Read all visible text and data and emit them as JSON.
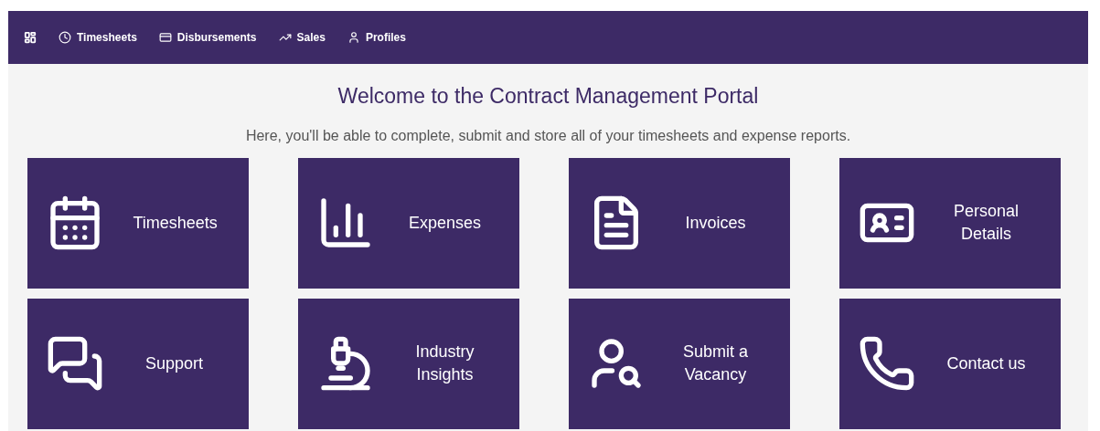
{
  "nav": {
    "items": [
      {
        "label": "Timesheets"
      },
      {
        "label": "Disbursements"
      },
      {
        "label": "Sales"
      },
      {
        "label": "Profiles"
      }
    ]
  },
  "title": "Welcome to the Contract Management Portal",
  "subtitle": "Here, you'll be able to complete, submit and store all of your timesheets and expense reports.",
  "tiles": [
    {
      "label": "Timesheets"
    },
    {
      "label": "Expenses"
    },
    {
      "label": "Invoices"
    },
    {
      "label": "Personal Details"
    },
    {
      "label": "Support"
    },
    {
      "label": "Industry Insights"
    },
    {
      "label": "Submit a Vacancy"
    },
    {
      "label": "Contact us"
    }
  ]
}
